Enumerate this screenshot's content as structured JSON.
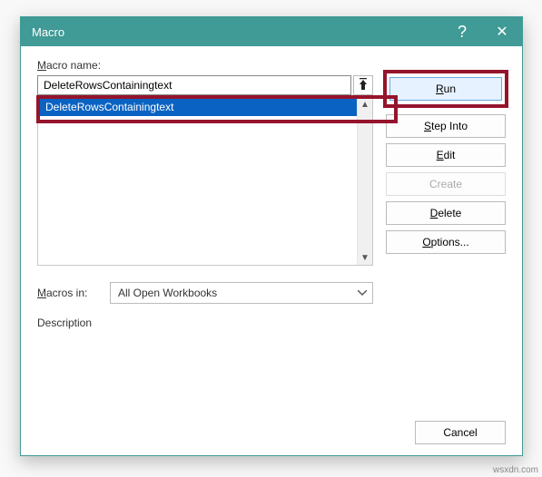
{
  "dialog": {
    "title": "Macro",
    "help_icon": "?",
    "close_icon": "✕"
  },
  "labels": {
    "macro_name_prefix": "M",
    "macro_name_rest": "acro name:",
    "macros_in_prefix": "M",
    "macros_in_rest": "acros in:",
    "description": "Description"
  },
  "input": {
    "value": "DeleteRowsContainingtext"
  },
  "list": {
    "items": [
      "DeleteRowsContainingtext"
    ],
    "selected_index": 0
  },
  "macros_in": {
    "value": "All Open Workbooks"
  },
  "buttons": {
    "run_prefix": "R",
    "run_suffix": "un",
    "step_prefix": "S",
    "step_suffix": "tep Into",
    "edit_prefix": "E",
    "edit_suffix": "dit",
    "create": "Create",
    "delete_prefix": "D",
    "delete_suffix": "elete",
    "options_prefix": "O",
    "options_suffix": "ptions...",
    "cancel": "Cancel"
  },
  "watermark": "wsxdn.com"
}
